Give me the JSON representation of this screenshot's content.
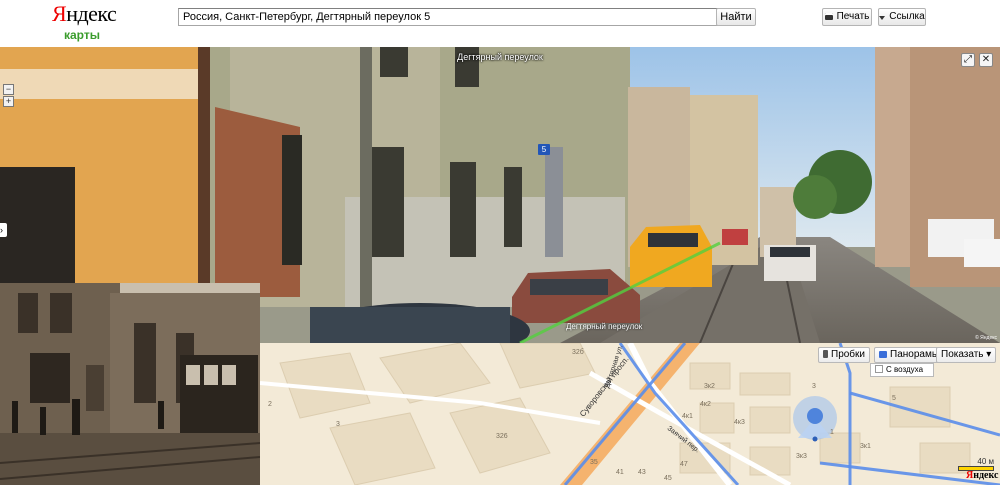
{
  "header": {
    "logo_first": "Я",
    "logo_rest": "ндекс",
    "logo_sub": "карты",
    "search_value": "Россия, Санкт-Петербург, Дегтярный переулок 5",
    "find_label": "Найти",
    "print_label": "Печать",
    "link_label": "Ссылка",
    "print_icon": "printer-icon",
    "link_icon": "pin-icon"
  },
  "panorama": {
    "title": "Дегтярный переулок",
    "road_label": "Дегтярный переулок",
    "house_number": "5",
    "zoom_out": "−",
    "zoom_in": "+",
    "expand_icon": "expand-icon",
    "close_icon": "close-icon",
    "nav_arrow": "›",
    "copyright": "© Яндекс"
  },
  "map": {
    "traffic_label": "Пробки",
    "panoramas_label": "Панорамы",
    "show_label": "Показать",
    "from_air_label": "С воздуха",
    "scale_label": "40 м",
    "logo_first": "Я",
    "logo_rest": "ндекс",
    "streets": [
      "Суворовский просп.",
      "Дегтярная ул.",
      "Заячий пер."
    ],
    "house_numbers": [
      "32б",
      "326",
      "3",
      "2",
      "35",
      "41",
      "43",
      "45",
      "47",
      "4к2",
      "4к3",
      "4к1",
      "3к3",
      "3",
      "1",
      "5",
      "3к1",
      "3к2"
    ]
  },
  "colors": {
    "logo_red": "#ee0000",
    "logo_green": "#3a9c2c",
    "map_bg": "#f3ead7",
    "major_road": "#f5b36e",
    "pano_road": "#5a8dea"
  }
}
